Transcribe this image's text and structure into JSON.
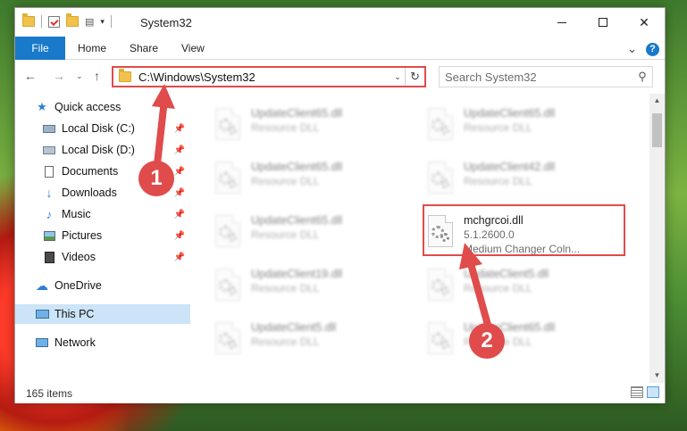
{
  "window": {
    "title": "System32",
    "controls": {
      "minimize": "—",
      "maximize": "☐",
      "close": "✕"
    }
  },
  "ribbon": {
    "tabs": [
      {
        "label": "File"
      },
      {
        "label": "Home"
      },
      {
        "label": "Share"
      },
      {
        "label": "View"
      }
    ],
    "expand_glyph": "⌄",
    "help_glyph": "?"
  },
  "addressbar": {
    "path": "C:\\Windows\\System32",
    "dropdown_glyph": "⌄",
    "refresh_glyph": "↻"
  },
  "search": {
    "placeholder": "Search System32",
    "glyph": "⚲"
  },
  "nav": {
    "back_glyph": "←",
    "forward_glyph": "→",
    "recent_glyph": "⌄",
    "up_glyph": "↑"
  },
  "sidebar": {
    "items": [
      {
        "label": "Quick access",
        "icon": "star-icon",
        "pinned": false
      },
      {
        "label": "Local Disk (C:)",
        "icon": "drive-icon",
        "pinned": true
      },
      {
        "label": "Local Disk (D:)",
        "icon": "drive-icon",
        "pinned": true
      },
      {
        "label": "Documents",
        "icon": "documents-icon",
        "pinned": true
      },
      {
        "label": "Downloads",
        "icon": "download-icon",
        "pinned": true
      },
      {
        "label": "Music",
        "icon": "music-icon",
        "pinned": true
      },
      {
        "label": "Pictures",
        "icon": "pictures-icon",
        "pinned": true
      },
      {
        "label": "Videos",
        "icon": "video-icon",
        "pinned": true
      },
      {
        "label": "OneDrive",
        "icon": "cloud-icon",
        "pinned": false
      },
      {
        "label": "This PC",
        "icon": "computer-icon",
        "pinned": false,
        "selected": true
      },
      {
        "label": "Network",
        "icon": "network-icon",
        "pinned": false
      }
    ]
  },
  "files": [
    {
      "name": "UpdateClient65.dll",
      "desc": "Resource DLL",
      "blurred": true
    },
    {
      "name": "UpdateClient65.dll",
      "desc": "Resource DLL",
      "blurred": true
    },
    {
      "name": "UpdateClient65.dll",
      "desc": "Resource DLL",
      "blurred": true
    },
    {
      "name": "UpdateClient42.dll",
      "desc": "Resource DLL",
      "blurred": true
    },
    {
      "name": "UpdateClient65.dll",
      "desc": "Resource DLL",
      "blurred": true
    },
    {
      "name": "mchgrcoi.dll",
      "desc": "5.1.2600.0",
      "desc2": "Medium Changer Coln...",
      "blurred": false
    },
    {
      "name": "UpdateClient19.dll",
      "desc": "Resource DLL",
      "blurred": true
    },
    {
      "name": "UpdateClient5.dll",
      "desc": "Resource DLL",
      "blurred": true
    },
    {
      "name": "UpdateClient5.dll",
      "desc": "Resource DLL",
      "blurred": true
    },
    {
      "name": "UpdateClient65.dll",
      "desc": "Resource DLL",
      "blurred": true
    }
  ],
  "status": {
    "item_count": "165 items"
  },
  "callouts": {
    "one": "1",
    "two": "2"
  },
  "colors": {
    "accent": "#1979ca",
    "highlight": "#e04b4b",
    "selected": "#cce4f7"
  }
}
